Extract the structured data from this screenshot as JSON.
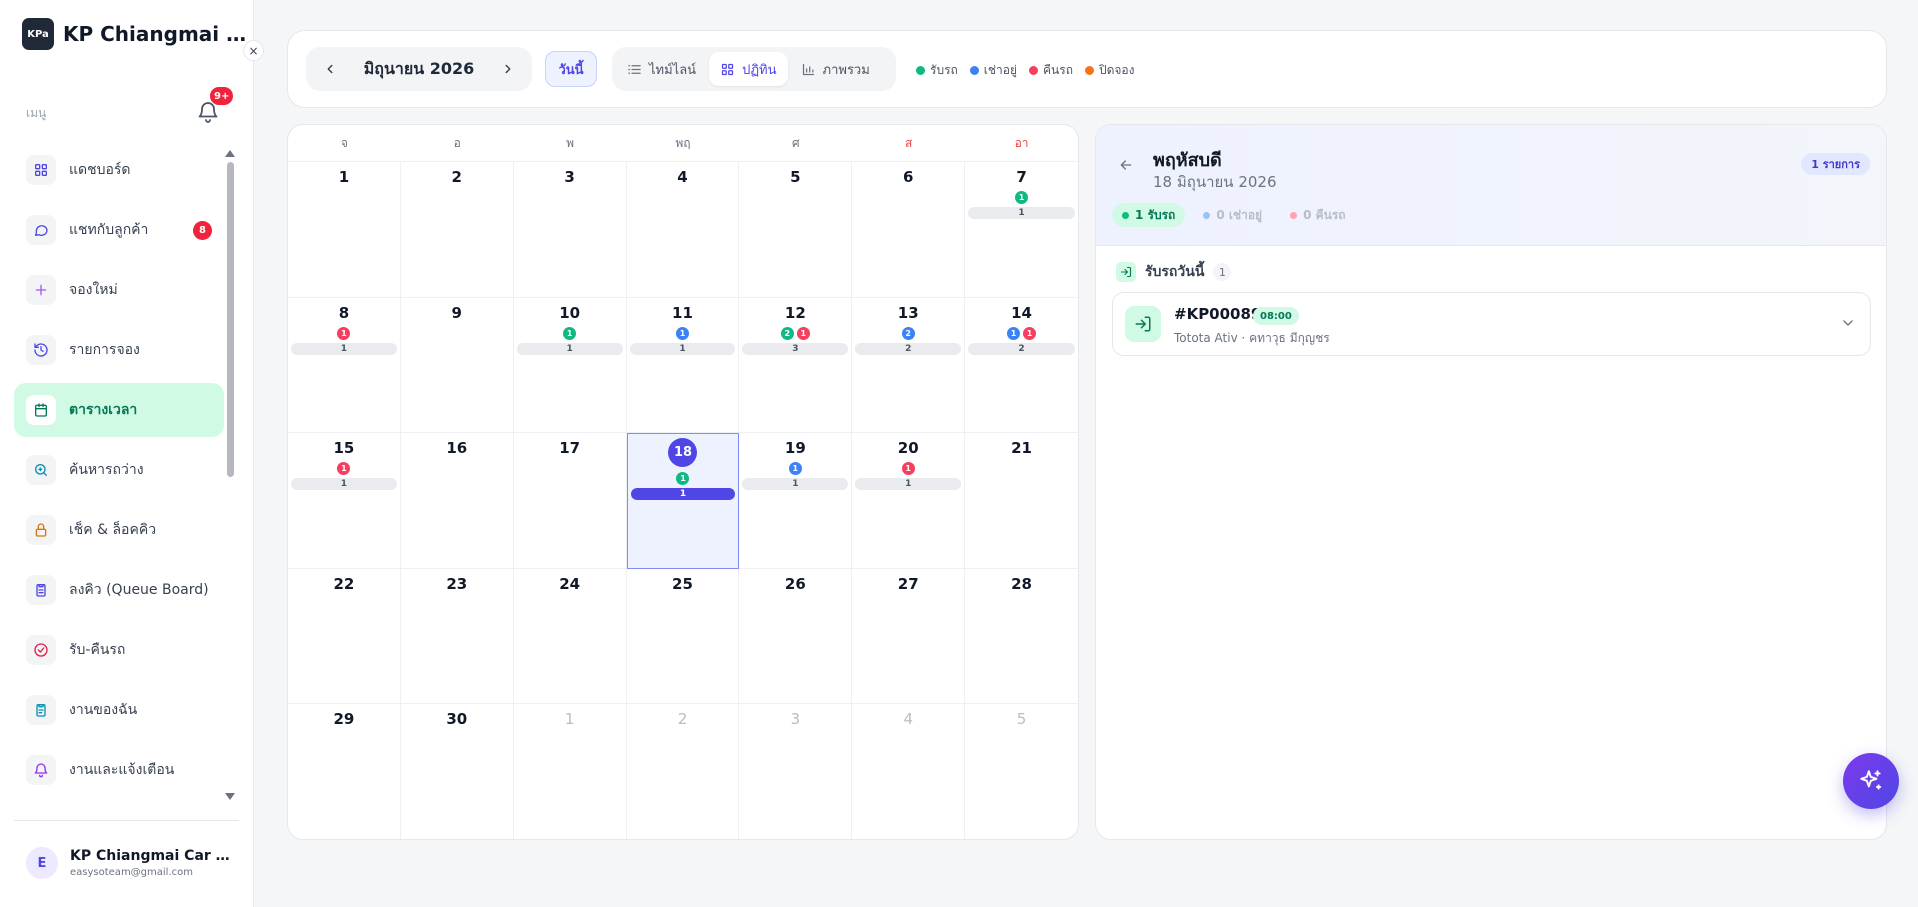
{
  "sidebar": {
    "brand_logo_text": "KPa",
    "brand_name": "KP Chiangmai Car Rental",
    "close_label": "×",
    "menu_label": "เมนู",
    "notification_badge": "9+",
    "items": [
      {
        "label": "แดชบอร์ด",
        "icon": "grid-icon",
        "icon_color": "#4f46e5",
        "active": false,
        "badge": ""
      },
      {
        "label": "แชทกับลูกค้า",
        "icon": "chat-icon",
        "icon_color": "#4f46e5",
        "active": false,
        "badge": "8"
      },
      {
        "label": "จองใหม่",
        "icon": "plus-icon",
        "icon_color": "#a855f7",
        "active": false,
        "badge": ""
      },
      {
        "label": "รายการจอง",
        "icon": "history-icon",
        "icon_color": "#4f46e5",
        "active": false,
        "badge": ""
      },
      {
        "label": "ตารางเวลา",
        "icon": "calendar-icon",
        "icon_color": "#047857",
        "active": true,
        "badge": ""
      },
      {
        "label": "ค้นหารถว่าง",
        "icon": "search-icon",
        "icon_color": "#0891b2",
        "active": false,
        "badge": ""
      },
      {
        "label": "เช็ค & ล็อคคิว",
        "icon": "lock-icon",
        "icon_color": "#d97706",
        "active": false,
        "badge": ""
      },
      {
        "label": "ลงคิว (Queue Board)",
        "icon": "clipboard-icon",
        "icon_color": "#4f46e5",
        "active": false,
        "badge": ""
      },
      {
        "label": "รับ-คืนรถ",
        "icon": "check-circle-icon",
        "icon_color": "#e11d48",
        "active": false,
        "badge": ""
      },
      {
        "label": "งานของฉัน",
        "icon": "task-icon",
        "icon_color": "#0891b2",
        "active": false,
        "badge": ""
      },
      {
        "label": "งานและแจ้งเตือน",
        "icon": "bell-icon",
        "icon_color": "#9333ea",
        "active": false,
        "badge": ""
      }
    ],
    "profile": {
      "initial": "E",
      "name": "KP Chiangmai Car Rental",
      "email": "easysoteam@gmail.com"
    }
  },
  "toolbar": {
    "month_label": "มิถุนายน 2026",
    "today_label": "วันนี้",
    "views": [
      {
        "label": "ไทม์ไลน์",
        "icon": "list-icon",
        "active": false
      },
      {
        "label": "ปฏิทิน",
        "icon": "grid-icon",
        "active": true
      },
      {
        "label": "ภาพรวม",
        "icon": "bar-chart-icon",
        "active": false
      }
    ],
    "legend": [
      {
        "label": "รับรถ",
        "color": "#10b981"
      },
      {
        "label": "เช่าอยู่",
        "color": "#3b82f6"
      },
      {
        "label": "คืนรถ",
        "color": "#f43f5e"
      },
      {
        "label": "ปิดจอง",
        "color": "#f97316"
      }
    ]
  },
  "calendar": {
    "weekdays": [
      {
        "label": "จ",
        "weekend": false
      },
      {
        "label": "อ",
        "weekend": false
      },
      {
        "label": "พ",
        "weekend": false
      },
      {
        "label": "พฤ",
        "weekend": false
      },
      {
        "label": "ศ",
        "weekend": false
      },
      {
        "label": "ส",
        "weekend": true
      },
      {
        "label": "อา",
        "weekend": true
      }
    ],
    "days": [
      {
        "day": "1"
      },
      {
        "day": "2"
      },
      {
        "day": "3"
      },
      {
        "day": "4"
      },
      {
        "day": "5"
      },
      {
        "day": "6"
      },
      {
        "day": "7",
        "dots": [
          {
            "type": "pickup",
            "n": "1"
          }
        ],
        "total": "1"
      },
      {
        "day": "8",
        "dots": [
          {
            "type": "return",
            "n": "1"
          }
        ],
        "total": "1"
      },
      {
        "day": "9"
      },
      {
        "day": "10",
        "dots": [
          {
            "type": "pickup",
            "n": "1"
          }
        ],
        "total": "1"
      },
      {
        "day": "11",
        "dots": [
          {
            "type": "renting",
            "n": "1"
          }
        ],
        "total": "1"
      },
      {
        "day": "12",
        "dots": [
          {
            "type": "pickup",
            "n": "2"
          },
          {
            "type": "return",
            "n": "1"
          }
        ],
        "total": "3"
      },
      {
        "day": "13",
        "dots": [
          {
            "type": "renting",
            "n": "2"
          }
        ],
        "total": "2"
      },
      {
        "day": "14",
        "dots": [
          {
            "type": "renting",
            "n": "1"
          },
          {
            "type": "return",
            "n": "1"
          }
        ],
        "total": "2"
      },
      {
        "day": "15",
        "dots": [
          {
            "type": "return",
            "n": "1"
          }
        ],
        "total": "1"
      },
      {
        "day": "16"
      },
      {
        "day": "17"
      },
      {
        "day": "18",
        "selected": true,
        "dots": [
          {
            "type": "pickup",
            "n": "1"
          }
        ],
        "total": "1"
      },
      {
        "day": "19",
        "dots": [
          {
            "type": "renting",
            "n": "1"
          }
        ],
        "total": "1"
      },
      {
        "day": "20",
        "dots": [
          {
            "type": "return",
            "n": "1"
          }
        ],
        "total": "1"
      },
      {
        "day": "21"
      },
      {
        "day": "22"
      },
      {
        "day": "23"
      },
      {
        "day": "24"
      },
      {
        "day": "25"
      },
      {
        "day": "26"
      },
      {
        "day": "27"
      },
      {
        "day": "28"
      },
      {
        "day": "29"
      },
      {
        "day": "30"
      },
      {
        "day": "1",
        "muted": true
      },
      {
        "day": "2",
        "muted": true
      },
      {
        "day": "3",
        "muted": true
      },
      {
        "day": "4",
        "muted": true
      },
      {
        "day": "5",
        "muted": true
      }
    ]
  },
  "detail": {
    "weekday": "พฤหัสบดี",
    "date": "18 มิถุนายน 2026",
    "count_label": "1 รายการ",
    "stats": [
      {
        "label": "1 รับรถ",
        "color": "#10b981",
        "active": true
      },
      {
        "label": "0 เช่าอยู่",
        "color": "#93c5fd",
        "active": false
      },
      {
        "label": "0 คืนรถ",
        "color": "#fda4af",
        "active": false
      }
    ],
    "section_label": "รับรถวันนี้",
    "section_count": "1",
    "booking": {
      "id": "#KP00089",
      "time": "08:00",
      "meta": "Totota Ativ · คทาวุธ มีกุญชร"
    }
  },
  "colors": {
    "pickup": "#10b981",
    "renting": "#3b82f6",
    "return": "#f43f5e",
    "accent": "#4f46e5"
  }
}
